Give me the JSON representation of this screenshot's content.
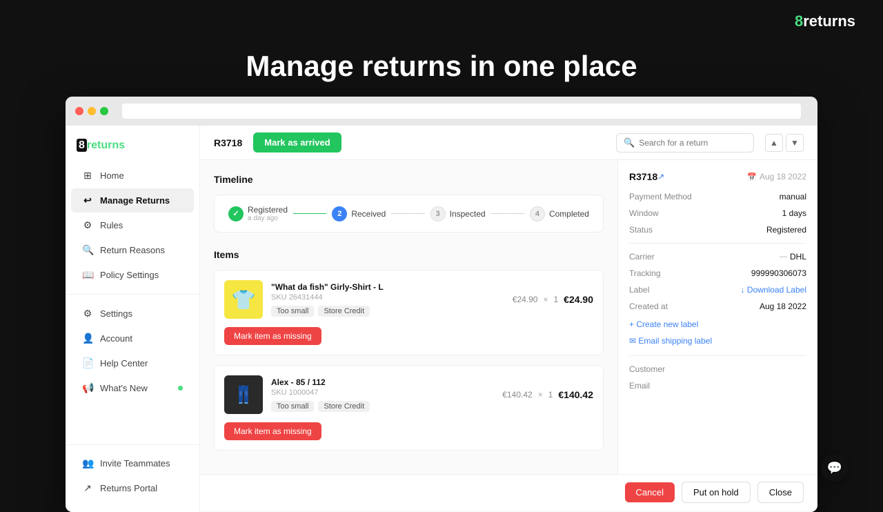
{
  "brand": {
    "name": "8returns",
    "logo": "8returns",
    "logo_prefix": "8",
    "logo_suffix": "returns"
  },
  "hero": {
    "title": "Manage returns in one place"
  },
  "sidebar": {
    "logo": "8returns",
    "items": [
      {
        "id": "home",
        "label": "Home",
        "icon": "⊞",
        "active": false
      },
      {
        "id": "manage-returns",
        "label": "Manage Returns",
        "icon": "↩",
        "active": true
      },
      {
        "id": "rules",
        "label": "Rules",
        "icon": "⚙",
        "active": false
      },
      {
        "id": "return-reasons",
        "label": "Return Reasons",
        "icon": "🔍",
        "active": false
      },
      {
        "id": "policy-settings",
        "label": "Policy Settings",
        "icon": "📖",
        "active": false
      },
      {
        "id": "settings",
        "label": "Settings",
        "icon": "⚙",
        "active": false
      },
      {
        "id": "account",
        "label": "Account",
        "icon": "👤",
        "active": false
      },
      {
        "id": "help-center",
        "label": "Help Center",
        "icon": "📄",
        "active": false
      },
      {
        "id": "whats-new",
        "label": "What's New",
        "icon": "📢",
        "active": false,
        "badge": true
      }
    ],
    "footer_items": [
      {
        "id": "invite-teammates",
        "label": "Invite Teammates",
        "icon": "👥"
      },
      {
        "id": "returns-portal",
        "label": "Returns Portal",
        "icon": "↗"
      }
    ]
  },
  "header": {
    "return_id": "R3718",
    "btn_arrived": "Mark as arrived",
    "search_placeholder": "Search for a return"
  },
  "timeline": {
    "title": "Timeline",
    "steps": [
      {
        "id": "registered",
        "label": "Registered",
        "sublabel": "a day ago",
        "state": "done",
        "number": "✓"
      },
      {
        "id": "received",
        "label": "Received",
        "state": "active",
        "number": "2"
      },
      {
        "id": "inspected",
        "label": "Inspected",
        "state": "pending",
        "number": "3"
      },
      {
        "id": "completed",
        "label": "Completed",
        "state": "pending",
        "number": "4"
      }
    ]
  },
  "items": {
    "title": "Items",
    "list": [
      {
        "id": "item-1",
        "name": "\"What da fish\" Girly-Shirt - L",
        "sku_label": "SKU",
        "sku": "26431444",
        "tags": [
          "Too small",
          "Store Credit"
        ],
        "unit_price": "€24.90",
        "qty": "1",
        "total": "€24.90",
        "btn_missing": "Mark item as missing",
        "thumb_type": "tshirt"
      },
      {
        "id": "item-2",
        "name": "Alex - 85 / 112",
        "sku_label": "SKU",
        "sku": "1000047",
        "tags": [
          "Too small",
          "Store Credit"
        ],
        "unit_price": "€140.42",
        "qty": "1",
        "total": "€140.42",
        "btn_missing": "Mark item as missing",
        "thumb_type": "pants"
      }
    ]
  },
  "right_panel": {
    "return_id": "R3718",
    "date_icon": "📅",
    "date": "Aug 18 2022",
    "fields": [
      {
        "key": "Payment Method",
        "value": "manual"
      },
      {
        "key": "Window",
        "value": "1 days"
      },
      {
        "key": "Status",
        "value": "Registered"
      },
      {
        "key": "Carrier",
        "value": "DHL",
        "carrier_prefix": "—"
      },
      {
        "key": "Tracking",
        "value": "999990306073"
      },
      {
        "key": "Label",
        "value": "",
        "link": "↓ Download Label"
      },
      {
        "key": "Created at",
        "value": "Aug 18 2022"
      }
    ],
    "label_links": [
      {
        "id": "create-new-label",
        "label": "+ Create new label"
      },
      {
        "id": "email-shipping-label",
        "label": "✉ Email shipping label"
      }
    ],
    "customer_section": "Customer",
    "email_label": "Email"
  },
  "action_bar": {
    "cancel_label": "Cancel",
    "hold_label": "Put on hold",
    "close_label": "Close"
  }
}
